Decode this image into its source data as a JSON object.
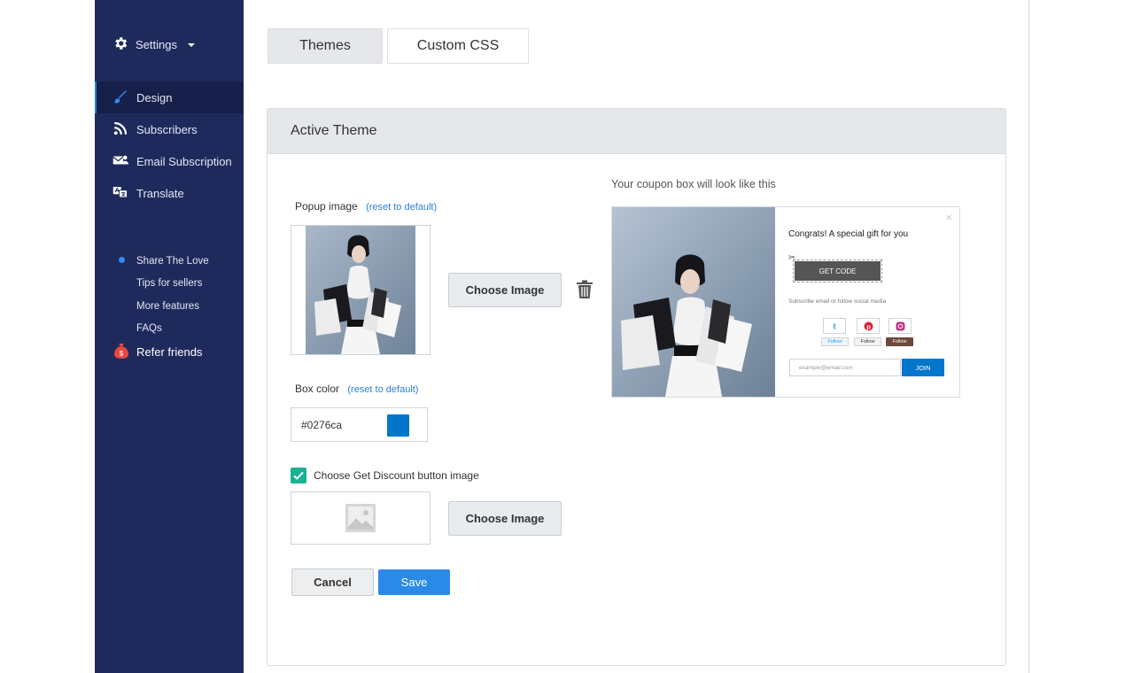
{
  "sidebar": {
    "settings_label": "Settings",
    "items": [
      {
        "label": "Design",
        "icon": "paintbrush-icon",
        "active": true
      },
      {
        "label": "Subscribers",
        "icon": "rss-icon"
      },
      {
        "label": "Email Subscription",
        "icon": "envelope-user-icon"
      },
      {
        "label": "Translate",
        "icon": "translate-icon"
      }
    ],
    "links": [
      {
        "label": "Share The Love"
      },
      {
        "label": "Tips for sellers"
      },
      {
        "label": "More features"
      },
      {
        "label": "FAQs"
      }
    ],
    "refer_label": "Refer friends"
  },
  "tabs": [
    {
      "label": "Themes",
      "active": true
    },
    {
      "label": "Custom CSS"
    }
  ],
  "panel": {
    "title": "Active Theme",
    "popup_image_label": "Popup image",
    "reset_label": "(reset to default)",
    "choose_image_label": "Choose Image",
    "box_color_label": "Box color",
    "box_color_value": "#0276ca",
    "discount_checkbox_label": "Choose Get Discount button image",
    "discount_checked": true,
    "cancel_label": "Cancel",
    "save_label": "Save"
  },
  "preview": {
    "caption": "Your coupon box will look like this",
    "close": "×",
    "title": "Congrats! A special gift for you",
    "code_label": "GET CODE",
    "subscribe_text": "Subscribe email or follow social media",
    "twitter_follow": "Follow",
    "pinterest_follow": "Follow",
    "instagram_follow": "Follow",
    "email_placeholder": "example@email.com",
    "join_label": "JOIN"
  },
  "colors": {
    "sidebar_bg": "#1f2a5c",
    "accent": "#2b8ae8",
    "box_color": "#0276ca",
    "checkbox": "#19b394"
  }
}
